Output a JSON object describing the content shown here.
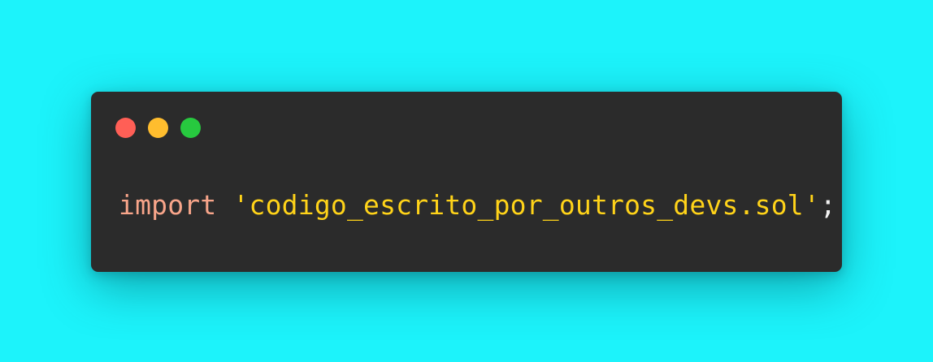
{
  "colors": {
    "background": "#1cf3fb",
    "window": "#2b2b2b",
    "close": "#ff5f56",
    "minimize": "#ffbd2e",
    "maximize": "#27c93f",
    "keyword": "#f8a58a",
    "string": "#ffd319",
    "punctuation": "#f2f2f2"
  },
  "window_controls": [
    "close-dot",
    "minimize-dot",
    "maximize-dot"
  ],
  "code": {
    "keyword": "import",
    "space": " ",
    "string": "'codigo_escrito_por_outros_devs.sol'",
    "punct": ";"
  }
}
